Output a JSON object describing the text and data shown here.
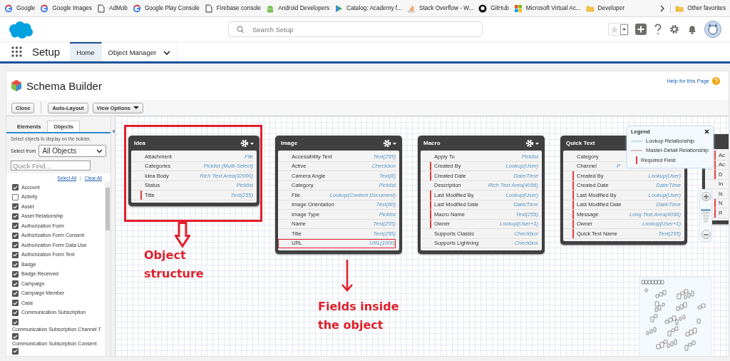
{
  "bookmarks": [
    {
      "label": "Google",
      "kind": "google"
    },
    {
      "label": "Google Images",
      "kind": "google"
    },
    {
      "label": "AdMob",
      "kind": "page"
    },
    {
      "label": "Google Play Console",
      "kind": "google"
    },
    {
      "label": "Firebase console",
      "kind": "page"
    },
    {
      "label": "Android Developers",
      "kind": "android"
    },
    {
      "label": "Catalog: Academy f...",
      "kind": "play"
    },
    {
      "label": "Stack Overflow - W...",
      "kind": "stack"
    },
    {
      "label": "GitHub",
      "kind": "github"
    },
    {
      "label": "Microsoft Virtual Ac...",
      "kind": "microsoft"
    },
    {
      "label": "Developer",
      "kind": "folder"
    }
  ],
  "other_bookmarks": {
    "label": "Other favorites",
    "kind": "folder"
  },
  "search": {
    "placeholder": "Search Setup"
  },
  "nav": {
    "app": "Setup",
    "tabs": [
      {
        "label": "Home",
        "selected": true,
        "menu": false
      },
      {
        "label": "Object Manager",
        "selected": false,
        "menu": true
      }
    ]
  },
  "page": {
    "title": "Schema Builder",
    "help": "Help for this Page"
  },
  "toolbar": [
    {
      "label": "Close",
      "menu": false
    },
    {
      "label": "Auto-Layout",
      "menu": false
    },
    {
      "label": "View Options",
      "menu": true
    }
  ],
  "sidebar": {
    "tabs": [
      {
        "label": "Elements",
        "selected": false
      },
      {
        "label": "Objects",
        "selected": true
      }
    ],
    "hint": "Select objects to display on the builder.",
    "select_label": "Select from",
    "select_value": "All Objects",
    "quick_find_placeholder": "Quick Find...",
    "select_all": "Select All",
    "separator": "|",
    "clear_all": "Clear All",
    "objects": [
      {
        "label": "Account",
        "checked": true
      },
      {
        "label": "Activity",
        "checked": false
      },
      {
        "label": "Asset",
        "checked": true
      },
      {
        "label": "Asset Relationship",
        "checked": true
      },
      {
        "label": "Authorization Form",
        "checked": true
      },
      {
        "label": "Authorization Form Consent",
        "checked": true
      },
      {
        "label": "Authorization Form Data Use",
        "checked": true
      },
      {
        "label": "Authorization Form Text",
        "checked": true
      },
      {
        "label": "Badge",
        "checked": true
      },
      {
        "label": "Badge Received",
        "checked": true
      },
      {
        "label": "Campaign",
        "checked": true
      },
      {
        "label": "Campaign Member",
        "checked": true
      },
      {
        "label": "Case",
        "checked": true
      },
      {
        "label": "Communication Subscription",
        "checked": true
      },
      {
        "label": "Communication Subscription Channel T",
        "checked": true
      },
      {
        "label": "Communication Subscription Consent",
        "checked": true
      },
      {
        "checked": true
      }
    ]
  },
  "cards": [
    {
      "title": "Idea",
      "menu": true,
      "fields": [
        {
          "name": "Attachment",
          "type": "File",
          "required": false
        },
        {
          "name": "Categories",
          "type": "Picklist (Multi-Select)",
          "required": false
        },
        {
          "name": "Idea Body",
          "type": "Rich Text Area(32000)",
          "required": false
        },
        {
          "name": "Status",
          "type": "Picklist",
          "required": false
        },
        {
          "name": "Title",
          "type": "Text(255)",
          "required": true
        }
      ]
    },
    {
      "title": "Image",
      "menu": true,
      "fields": [
        {
          "name": "Accessibility Text",
          "type": "Text(255)",
          "required": false
        },
        {
          "name": "Active",
          "type": "Checkbox",
          "required": false
        },
        {
          "name": "Camera Angle",
          "type": "Text(8)",
          "required": false
        },
        {
          "name": "Category",
          "type": "Picklist",
          "required": false
        },
        {
          "name": "File",
          "type": "Lookup(Content Document)",
          "required": false
        },
        {
          "name": "Image Orientation",
          "type": "Text(80)",
          "required": false
        },
        {
          "name": "Image Type",
          "type": "Picklist",
          "required": false
        },
        {
          "name": "Name",
          "type": "Text(255)",
          "required": false
        },
        {
          "name": "Title",
          "type": "Text(255)",
          "required": false
        },
        {
          "name": "URL",
          "type": "URL(1000)",
          "required": false,
          "annotated": true
        }
      ]
    },
    {
      "title": "Macro",
      "menu": true,
      "fields": [
        {
          "name": "Apply To",
          "type": "Picklist",
          "required": false
        },
        {
          "name": "Created By",
          "type": "Lookup(User)",
          "required": true
        },
        {
          "name": "Created Date",
          "type": "Date/Time",
          "required": true
        },
        {
          "name": "Description",
          "type": "Rich Text Area(4096)",
          "required": false
        },
        {
          "name": "Last Modified By",
          "type": "Lookup(User)",
          "required": true
        },
        {
          "name": "Last Modified Date",
          "type": "Date/Time",
          "required": true
        },
        {
          "name": "Macro Name",
          "type": "Text(255)",
          "required": true
        },
        {
          "name": "Owner",
          "type": "Lookup(User+1)",
          "required": true
        },
        {
          "name": "Supports Classic",
          "type": "Checkbox",
          "required": false
        },
        {
          "name": "Supports Lightning",
          "type": "Checkbox",
          "required": false
        }
      ]
    },
    {
      "title": "Quick Text",
      "menu": false,
      "fields": [
        {
          "name": "Category",
          "required": false
        },
        {
          "name": "Channel",
          "type": "P",
          "clipped": true,
          "required": false
        },
        {
          "name": "Created By",
          "type": "Lookup(User)",
          "required": true
        },
        {
          "name": "Created Date",
          "type": "Date/Time",
          "required": true
        },
        {
          "name": "Last Modified By",
          "type": "Lookup(User)",
          "required": true
        },
        {
          "name": "Last Modified Date",
          "type": "Date/Time",
          "required": true
        },
        {
          "name": "Message",
          "type": "Long Text Area(4096)",
          "required": true
        },
        {
          "name": "Owner",
          "type": "Lookup(User+1)",
          "required": true
        },
        {
          "name": "Quick Text Name",
          "type": "Text(255)",
          "required": true
        }
      ]
    },
    {
      "menu": false,
      "fields": [
        {
          "name": "Ac",
          "required": true
        },
        {
          "name": "Ac",
          "required": true
        },
        {
          "name": "D",
          "required": true
        },
        {
          "name": "In",
          "required": false
        },
        {
          "name": "Is",
          "required": false
        },
        {
          "name": "N",
          "required": true
        },
        {
          "name": "R",
          "required": true
        }
      ]
    }
  ],
  "legend": {
    "title": "Legend",
    "items": [
      {
        "kind": "lookup",
        "label": "Lookup Relationship"
      },
      {
        "kind": "master",
        "label": "Master-Detail Relationship"
      },
      {
        "kind": "required",
        "label": "Required Field"
      }
    ]
  },
  "zoom": {
    "level": 1
  },
  "annotations": [
    {
      "kind": "object",
      "text": "Object structure"
    },
    {
      "kind": "fields",
      "text": "Fields inside the object"
    }
  ]
}
